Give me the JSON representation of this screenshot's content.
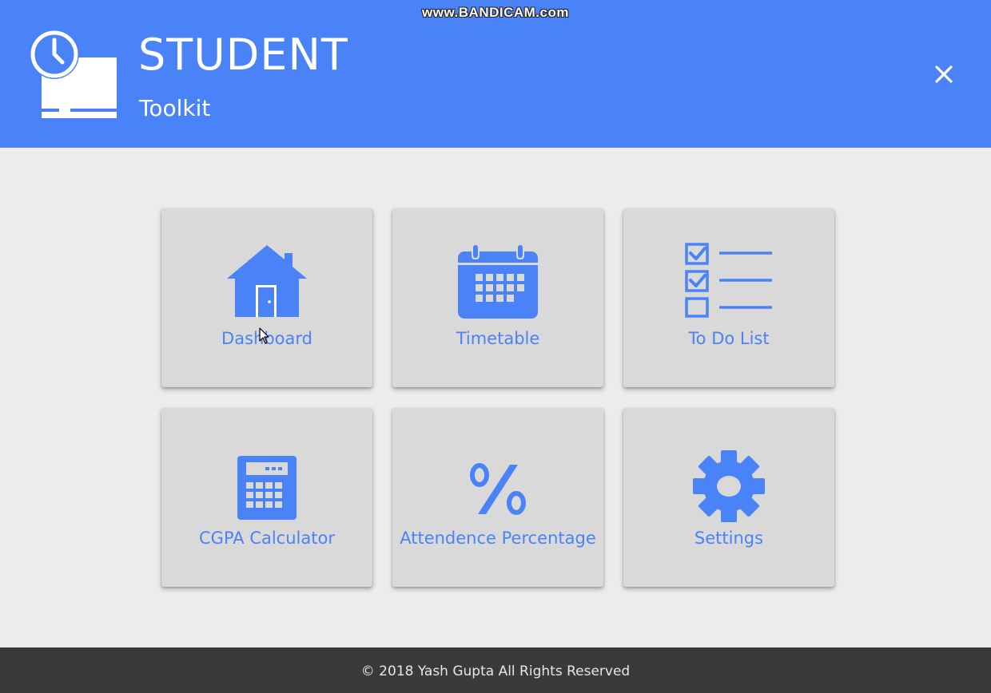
{
  "watermark": "www.BANDICAM.com",
  "header": {
    "title": "STUDENT",
    "subtitle": "Toolkit",
    "logo_icon": "clock-computer-icon",
    "close_icon": "close-icon"
  },
  "tiles": [
    {
      "label": "Dashboard",
      "icon": "house-icon"
    },
    {
      "label": "Timetable",
      "icon": "calendar-icon"
    },
    {
      "label": "To Do List",
      "icon": "checklist-icon"
    },
    {
      "label": "CGPA Calculator",
      "icon": "calculator-icon"
    },
    {
      "label": "Attendence Percentage",
      "icon": "percent-icon"
    },
    {
      "label": "Settings",
      "icon": "gear-icon"
    }
  ],
  "footer": {
    "text": "© 2018 Yash Gupta All Rights Reserved"
  },
  "colors": {
    "accent": "#4a82f7",
    "background": "#ececec",
    "tile": "#d9d9d9",
    "footer": "#3a3a3a"
  }
}
